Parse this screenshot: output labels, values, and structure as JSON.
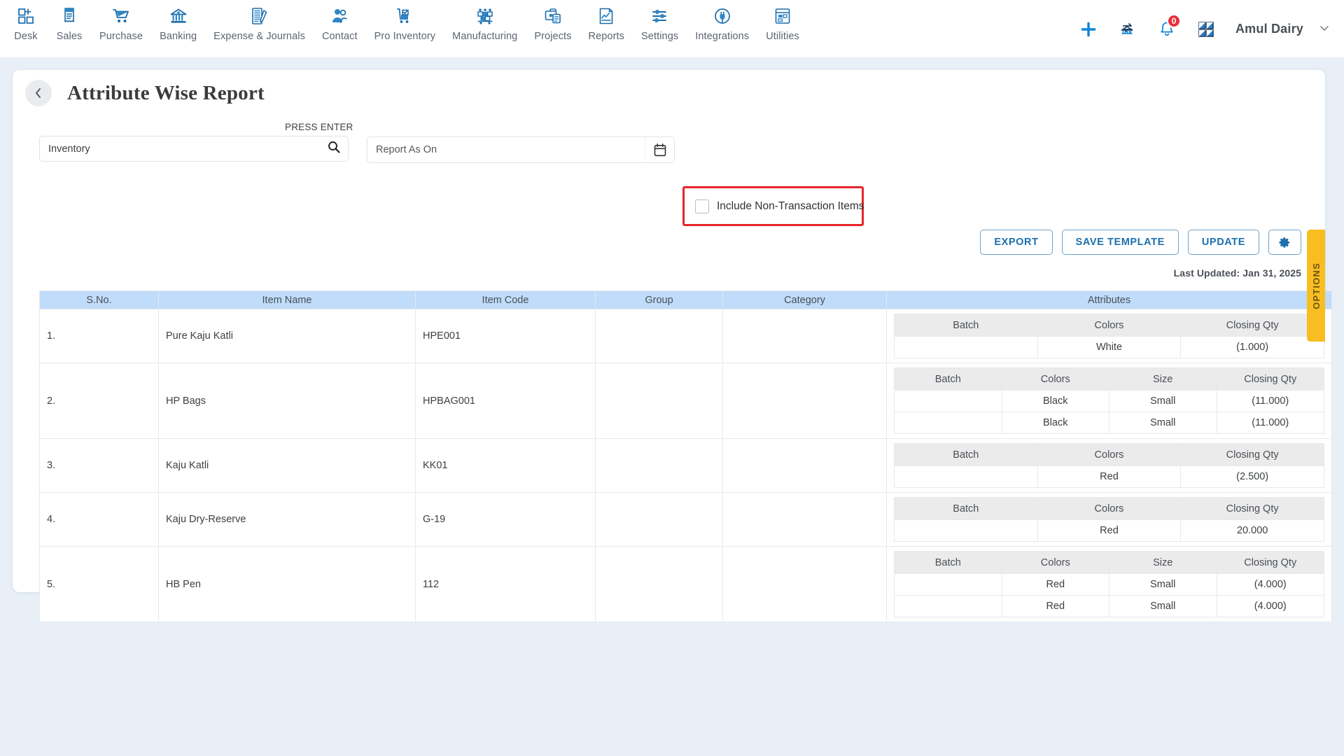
{
  "nav": {
    "items": [
      {
        "label": "Desk",
        "icon": "desk-grid-plus-icon"
      },
      {
        "label": "Sales",
        "icon": "sales-receipt-icon"
      },
      {
        "label": "Purchase",
        "icon": "purchase-cart-icon"
      },
      {
        "label": "Banking",
        "icon": "banking-bank-icon"
      },
      {
        "label": "Expense & Journals",
        "icon": "expense-journal-icon"
      },
      {
        "label": "Contact",
        "icon": "contact-people-icon"
      },
      {
        "label": "Pro Inventory",
        "icon": "pro-inventory-trolley-icon"
      },
      {
        "label": "Manufacturing",
        "icon": "manufacturing-boxes-icon"
      },
      {
        "label": "Projects",
        "icon": "projects-briefcase-icon"
      },
      {
        "label": "Reports",
        "icon": "reports-chart-icon"
      },
      {
        "label": "Settings",
        "icon": "settings-sliders-icon"
      },
      {
        "label": "Integrations",
        "icon": "integrations-plug-icon"
      },
      {
        "label": "Utilities",
        "icon": "utilities-window-icon"
      }
    ],
    "right": {
      "add_icon": "plus-icon",
      "transfer_icon": "bank-transfer-icon",
      "notification_icon": "bell-icon",
      "notification_count": "0",
      "apps_icon": "apps-grid-icon",
      "org_name": "Amul Dairy",
      "org_caret": "chevron-down-icon"
    }
  },
  "header": {
    "back_icon": "back-chevron-icon",
    "title": "Attribute Wise Report"
  },
  "filters": {
    "press_enter_label": "PRESS ENTER",
    "search_value": "Inventory",
    "search_placeholder": "Inventory",
    "search_icon": "search-icon",
    "date_value": "",
    "date_placeholder": "Report As On",
    "calendar_icon": "calendar-icon",
    "checkbox_label": "Include Non-Transaction Items",
    "checkbox_checked": false,
    "highlight_color": "#e8252a"
  },
  "actions": {
    "export": "EXPORT",
    "save_template": "SAVE TEMPLATE",
    "update": "UPDATE",
    "gear_icon": "gear-icon",
    "last_updated": "Last Updated: Jan 31, 2025"
  },
  "options_tab": {
    "label": "OPTIONS",
    "color": "#f8bd20"
  },
  "table": {
    "columns": [
      "S.No.",
      "Item Name",
      "Item Code",
      "Group",
      "Category",
      "Attributes"
    ],
    "rows": [
      {
        "sno": "1.",
        "item_name": "Pure Kaju Katli",
        "item_code": "HPE001",
        "group": "",
        "category": "",
        "attr_headers": [
          "Batch",
          "Colors",
          "Closing Qty"
        ],
        "attr_rows": [
          [
            "",
            "White",
            "(1.000)"
          ]
        ]
      },
      {
        "sno": "2.",
        "item_name": "HP Bags",
        "item_code": "HPBAG001",
        "group": "",
        "category": "",
        "attr_headers": [
          "Batch",
          "Colors",
          "Size",
          "Closing Qty"
        ],
        "attr_rows": [
          [
            "",
            "Black",
            "Small",
            "(11.000)"
          ],
          [
            "",
            "Black",
            "Small",
            "(11.000)"
          ]
        ]
      },
      {
        "sno": "3.",
        "item_name": "Kaju Katli",
        "item_code": "KK01",
        "group": "",
        "category": "",
        "attr_headers": [
          "Batch",
          "Colors",
          "Closing Qty"
        ],
        "attr_rows": [
          [
            "",
            "Red",
            "(2.500)"
          ]
        ]
      },
      {
        "sno": "4.",
        "item_name": "Kaju Dry-Reserve",
        "item_code": "G-19",
        "group": "",
        "category": "",
        "attr_headers": [
          "Batch",
          "Colors",
          "Closing Qty"
        ],
        "attr_rows": [
          [
            "",
            "Red",
            "20.000"
          ]
        ]
      },
      {
        "sno": "5.",
        "item_name": "HB Pen",
        "item_code": "112",
        "group": "",
        "category": "",
        "attr_headers": [
          "Batch",
          "Colors",
          "Size",
          "Closing Qty"
        ],
        "attr_rows": [
          [
            "",
            "Red",
            "Small",
            "(4.000)"
          ],
          [
            "",
            "Red",
            "Small",
            "(4.000)"
          ]
        ]
      }
    ]
  }
}
